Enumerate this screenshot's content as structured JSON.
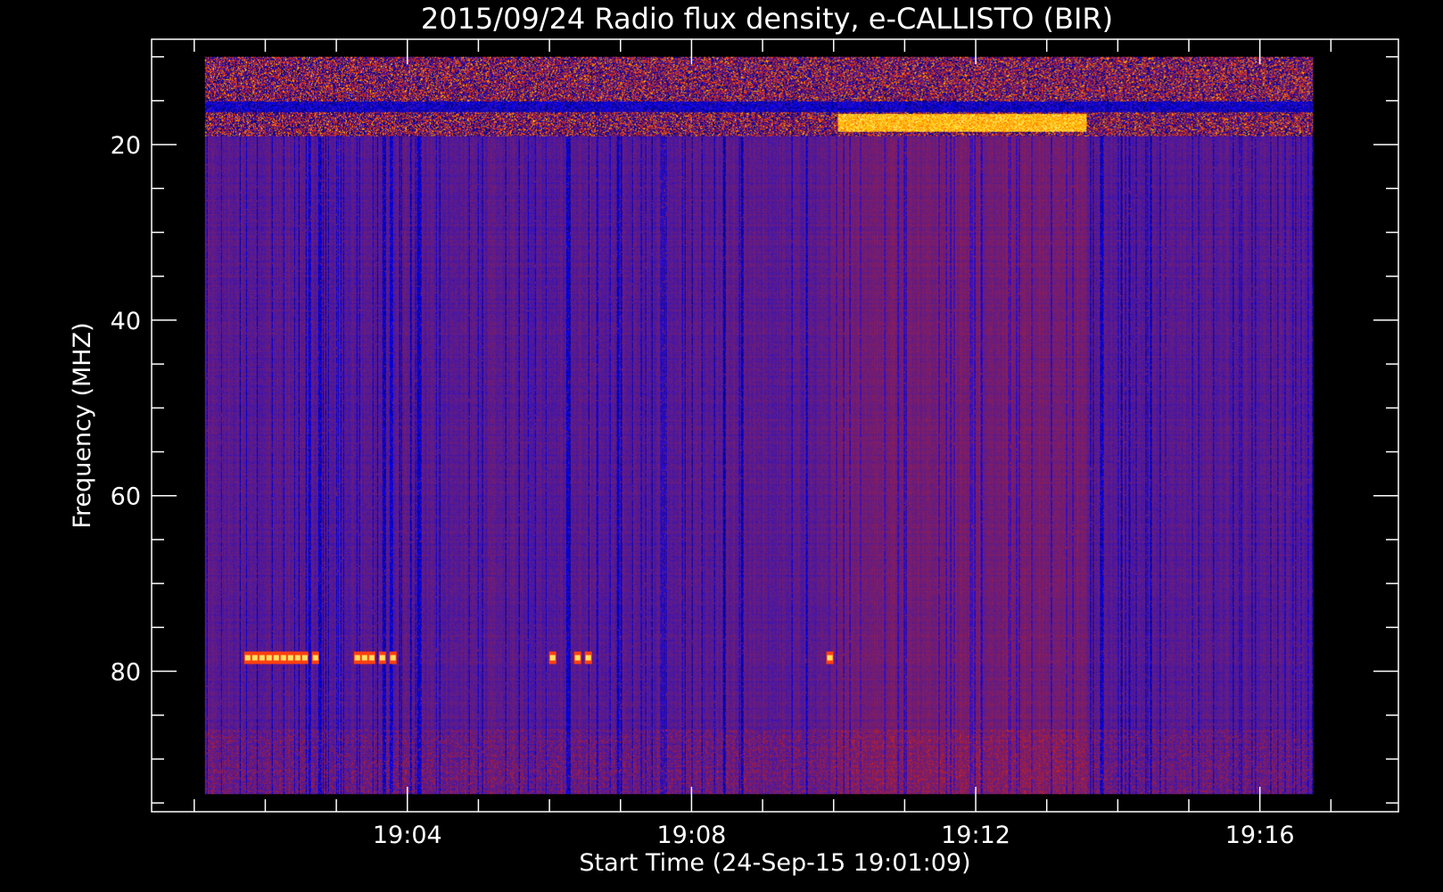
{
  "chart_data": {
    "type": "heatmap",
    "title": "2015/09/24  Radio flux density, e-CALLISTO (BIR)",
    "xlabel": "Start Time (24-Sep-15 19:01:09)",
    "ylabel": "Frequency (MHZ)",
    "x_tick_labels": [
      "19:04",
      "19:08",
      "19:12",
      "19:16"
    ],
    "y_tick_labels": [
      "20",
      "40",
      "60",
      "80"
    ],
    "x_range_minutes": [
      0,
      15.6
    ],
    "x_axis_extent_minutes": [
      -0.75,
      16.8
    ],
    "y_range_mhz": [
      10,
      94
    ],
    "y_axis_extent_mhz": [
      8,
      96
    ],
    "y_inverted": true,
    "colormap": [
      "#000000",
      "#0000ff",
      "#5a1c8c",
      "#b41e2d",
      "#ff3c00",
      "#ffd200",
      "#ffffff"
    ],
    "background_intensity": 0.33,
    "features": {
      "dark_vertical_stripes_minutes": [
        1.45,
        1.6,
        1.95,
        2.5,
        2.6,
        2.9,
        3.0,
        3.3,
        3.9,
        5.1,
        5.4,
        5.8,
        7.3,
        12.5,
        12.6,
        12.9,
        13.3,
        14.2
      ],
      "bright_band_mhz": [
        10,
        19
      ],
      "bright_segment": {
        "t_start_minutes": 8.9,
        "t_end_minutes": 12.4,
        "f_mhz": [
          16.5,
          18.5
        ]
      },
      "interference_blips_80mhz_minutes": [
        0.55,
        0.65,
        0.75,
        0.85,
        0.95,
        1.05,
        1.15,
        1.25,
        1.35,
        1.5,
        2.1,
        2.2,
        2.3,
        2.45,
        2.6,
        4.85,
        5.2,
        5.35,
        8.75
      ],
      "interference_blips_freq_mhz": [
        78.2,
        78.8
      ],
      "reddish_region_minutes": [
        8.8,
        12.4
      ]
    }
  }
}
